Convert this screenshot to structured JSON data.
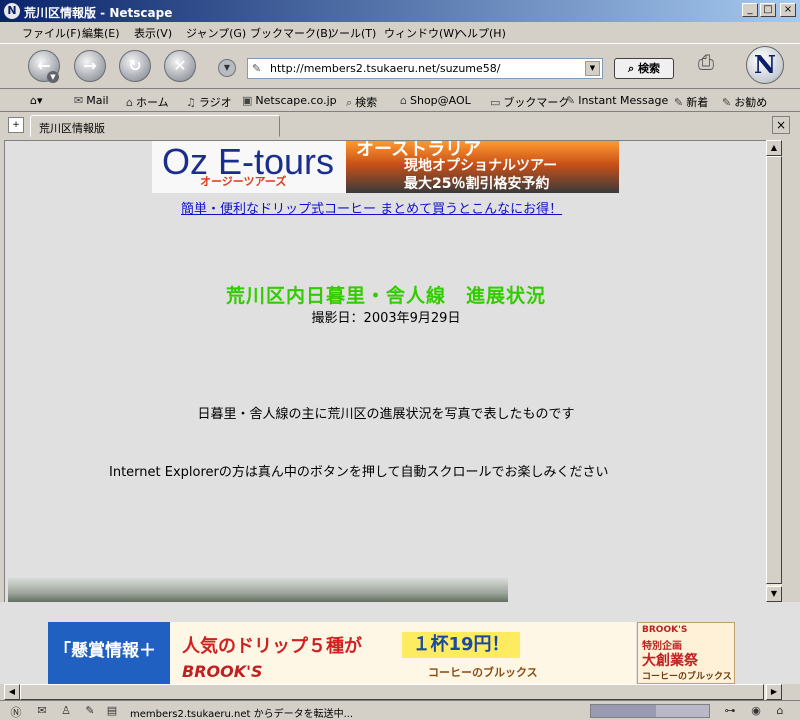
{
  "window": {
    "title": "荒川区情報版 - Netscape",
    "app_icon_glyph": "N"
  },
  "menu": [
    "ファイル(F)",
    "編集(E)",
    "表示(V)",
    "ジャンプ(G)",
    "ブックマーク(B)",
    "ツール(T)",
    "ウィンドウ(W)",
    "ヘルプ(H)"
  ],
  "nav": {
    "url": "http://members2.tsukaeru.net/suzume58/",
    "search_label": "検索",
    "logo_glyph": "N"
  },
  "bookmarks": [
    "Mail",
    "ホーム",
    "ラジオ",
    "Netscape.co.jp",
    "検索",
    "Shop@AOL",
    "ブックマーク",
    "Instant Message",
    "新着",
    "お勧め"
  ],
  "tab": {
    "label": "荒川区情報版"
  },
  "content": {
    "banner_oz": {
      "title": "Oz E-tours",
      "subtitle": "オージーツアーズ"
    },
    "banner_aus": {
      "line1": "オーストラリア",
      "line2": "現地オプショナルツアー",
      "line3": "最大25％割引格安予約"
    },
    "coffee_link": "簡単・便利なドリップ式コーヒー まとめて買うとこんなにお得！",
    "heading": "荒川区内日暮里・舎人線　進展状況",
    "photo_date": "撮影日：2003年9月29日",
    "description": "日暮里・舎人線の主に荒川区の進展状況を写真で表したものです",
    "ie_note": "Internet Explorerの方は真ん中のボタンを押して自動スクロールでお楽しみください"
  },
  "bottom_banners": {
    "left_text": "「懸賞情報＋",
    "mid_headline": "人気のドリップ５種が",
    "mid_price": "１杯19円！",
    "mid_brand": "BROOK'S",
    "mid_sub": "コーヒーのブルックス",
    "right_brand": "BROOK'S",
    "right_special": "特別企画",
    "right_main": "大創業祭",
    "right_sub": "コーヒーのブルックス"
  },
  "status": {
    "text": "members2.tsukaeru.net からデータを転送中...",
    "progress": 0.55
  },
  "colors": {
    "heading": "#33cc00",
    "link": "#1010cc",
    "titlebar": "#0a246a"
  }
}
